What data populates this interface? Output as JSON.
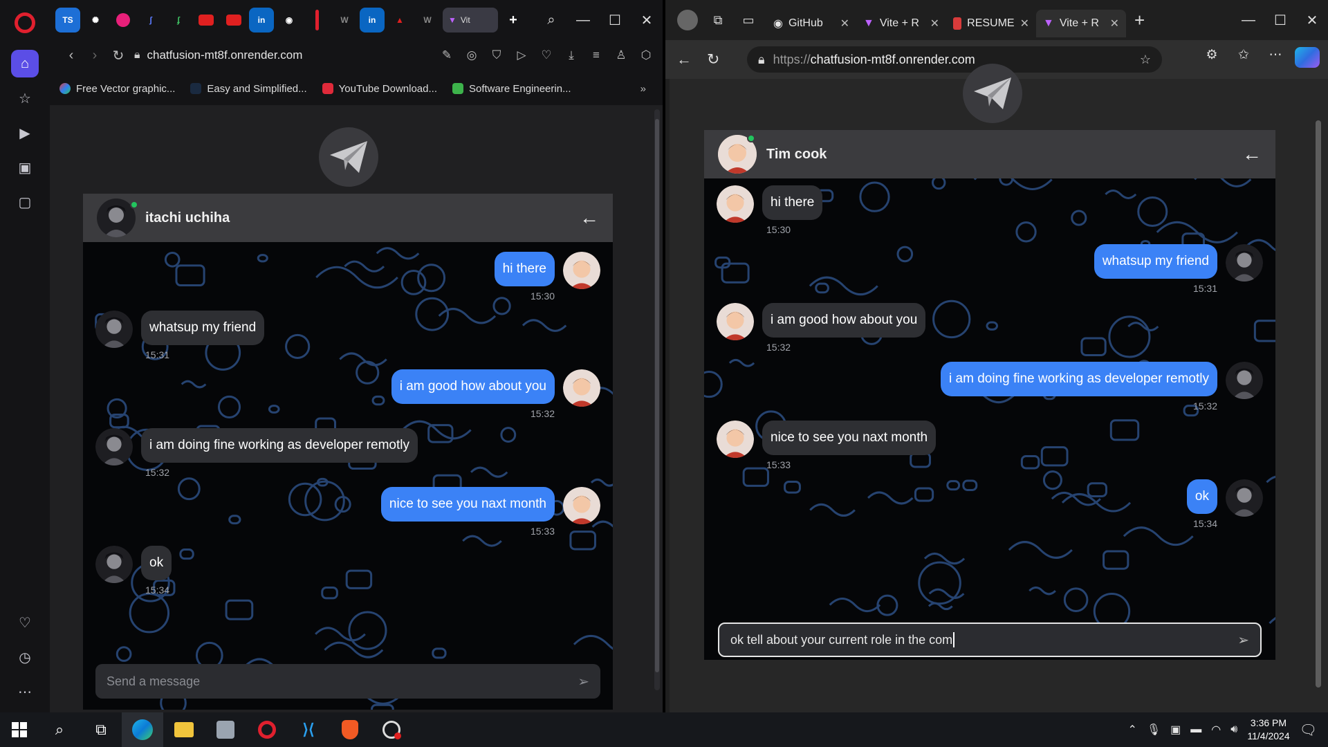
{
  "taskbar": {
    "time": "3:36 PM",
    "date": "11/4/2024"
  },
  "opera": {
    "active_tab": "Vit",
    "url": "chatfusion-mt8f.onrender.com",
    "bookmarks": [
      "Free Vector graphic...",
      "Easy and Simplified...",
      "YouTube Download...",
      "Software Engineerin..."
    ],
    "chat": {
      "contact": "itachi uchiha",
      "messages": [
        {
          "dir": "out",
          "text": "hi there",
          "time": "15:30"
        },
        {
          "dir": "in",
          "text": "whatsup my friend",
          "time": "15:31"
        },
        {
          "dir": "out",
          "text": "i am good how about you",
          "time": "15:32"
        },
        {
          "dir": "in",
          "text": "i am doing fine working as developer remotly",
          "time": "15:32"
        },
        {
          "dir": "out",
          "text": "nice to see you naxt month",
          "time": "15:33"
        },
        {
          "dir": "in",
          "text": "ok",
          "time": "15:34"
        }
      ],
      "input_value": "",
      "placeholder": "Send a message"
    }
  },
  "edge": {
    "tabs": [
      {
        "label": "GitHub"
      },
      {
        "label": "Vite + R"
      },
      {
        "label": "RESUME"
      },
      {
        "label": "Vite + R",
        "active": true
      }
    ],
    "url_prefix": "https://",
    "url_host": "chatfusion-mt8f.onrender.com",
    "chat": {
      "contact": "Tim cook",
      "messages": [
        {
          "dir": "in",
          "text": "hi there",
          "time": "15:30"
        },
        {
          "dir": "out",
          "text": "whatsup my friend",
          "time": "15:31"
        },
        {
          "dir": "in",
          "text": "i am good how about you",
          "time": "15:32"
        },
        {
          "dir": "out",
          "text": "i am doing fine working as developer remotly",
          "time": "15:32"
        },
        {
          "dir": "in",
          "text": "nice to see you naxt month",
          "time": "15:33"
        },
        {
          "dir": "out",
          "text": "ok",
          "time": "15:34"
        }
      ],
      "input_value": "ok tell about your current role in the com",
      "placeholder": "Send a message"
    }
  },
  "colors": {
    "accent": "#3b82f6",
    "opera_red": "#e0202e",
    "online": "#22c55e"
  }
}
